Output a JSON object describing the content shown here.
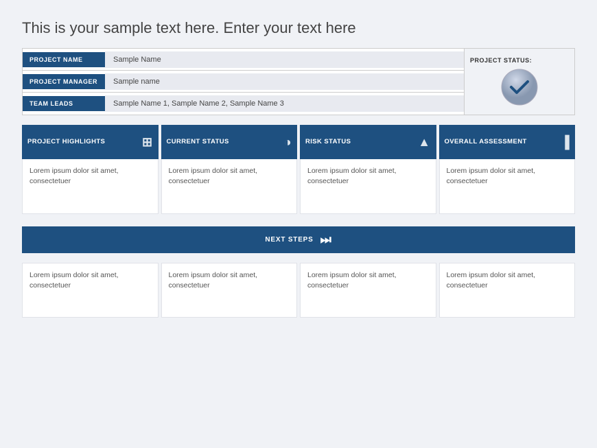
{
  "slide": {
    "title": "This is your sample text here. Enter your text here",
    "info_table": {
      "rows": [
        {
          "label": "PROJECT NAME",
          "value": "Sample Name"
        },
        {
          "label": "PROJECT MANAGER",
          "value": "Sample name"
        },
        {
          "label": "TEAM LEADS",
          "value": "Sample Name 1, Sample Name 2, Sample Name 3"
        }
      ],
      "status_label": "PROJECT STATUS:"
    },
    "columns": [
      {
        "header": "PROJECT HIGHLIGHTS",
        "icon": "📊",
        "icon_name": "presentation-icon",
        "body": "Lorem ipsum dolor sit amet, consectetuer"
      },
      {
        "header": "CURRENT STATUS",
        "icon": "🥧",
        "icon_name": "pie-chart-icon",
        "body": "Lorem ipsum dolor sit amet, consectetuer"
      },
      {
        "header": "RISK STATUS",
        "icon": "⚠",
        "icon_name": "warning-icon",
        "body": "Lorem ipsum dolor sit amet, consectetuer"
      },
      {
        "header": "OVERALL ASSESSMENT",
        "icon": "📈",
        "icon_name": "bar-chart-icon",
        "body": "Lorem ipsum dolor sit amet, consectetuer"
      }
    ],
    "next_steps": {
      "label": "NEXT STEPS",
      "icon_name": "skip-forward-icon"
    },
    "bottom_columns": [
      "Lorem ipsum dolor sit amet, consectetuer",
      "Lorem ipsum dolor sit amet, consectetuer",
      "Lorem ipsum dolor sit amet, consectetuer",
      "Lorem ipsum dolor sit amet, consectetuer"
    ]
  }
}
